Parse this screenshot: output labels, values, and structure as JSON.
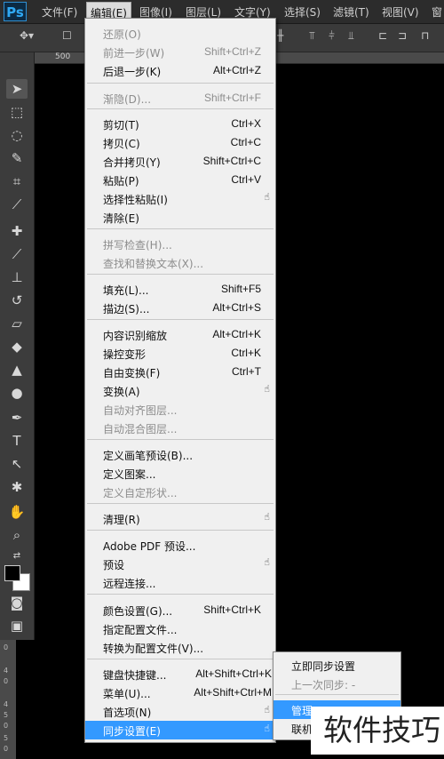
{
  "app": {
    "logo": "Ps"
  },
  "menubar": [
    "文件(F)",
    "编辑(E)",
    "图像(I)",
    "图层(L)",
    "文字(Y)",
    "选择(S)",
    "滤镜(T)",
    "视图(V)",
    "窗"
  ],
  "ruler": {
    "tick": "500",
    "left_ticks": [
      "0",
      "4",
      "0",
      "4",
      "5",
      "0",
      "5",
      "0"
    ]
  },
  "edit_menu": [
    {
      "label": "还原(O)",
      "shortcut": "",
      "disabled": true
    },
    {
      "label": "前进一步(W)",
      "shortcut": "Shift+Ctrl+Z",
      "disabled": true
    },
    {
      "label": "后退一步(K)",
      "shortcut": "Alt+Ctrl+Z"
    },
    {
      "label": "渐隐(D)...",
      "shortcut": "Shift+Ctrl+F",
      "disabled": true
    },
    {
      "label": "剪切(T)",
      "shortcut": "Ctrl+X"
    },
    {
      "label": "拷贝(C)",
      "shortcut": "Ctrl+C"
    },
    {
      "label": "合并拷贝(Y)",
      "shortcut": "Shift+Ctrl+C"
    },
    {
      "label": "粘贴(P)",
      "shortcut": "Ctrl+V"
    },
    {
      "label": "选择性粘贴(I)",
      "shortcut": "",
      "submenu": true
    },
    {
      "label": "清除(E)",
      "shortcut": ""
    },
    {
      "label": "拼写检查(H)...",
      "shortcut": "",
      "disabled": true
    },
    {
      "label": "查找和替换文本(X)...",
      "shortcut": "",
      "disabled": true
    },
    {
      "label": "填充(L)...",
      "shortcut": "Shift+F5"
    },
    {
      "label": "描边(S)...",
      "shortcut": "Alt+Ctrl+S"
    },
    {
      "label": "内容识别缩放",
      "shortcut": "Alt+Ctrl+K"
    },
    {
      "label": "操控变形",
      "shortcut": "Ctrl+K"
    },
    {
      "label": "自由变换(F)",
      "shortcut": "Ctrl+T"
    },
    {
      "label": "变换(A)",
      "shortcut": "",
      "submenu": true
    },
    {
      "label": "自动对齐图层...",
      "shortcut": "",
      "disabled": true
    },
    {
      "label": "自动混合图层...",
      "shortcut": "",
      "disabled": true
    },
    {
      "label": "定义画笔预设(B)...",
      "shortcut": ""
    },
    {
      "label": "定义图案...",
      "shortcut": ""
    },
    {
      "label": "定义自定形状...",
      "shortcut": "",
      "disabled": true
    },
    {
      "label": "清理(R)",
      "shortcut": "",
      "submenu": true
    },
    {
      "label": "Adobe PDF 预设...",
      "shortcut": ""
    },
    {
      "label": "预设",
      "shortcut": "",
      "submenu": true
    },
    {
      "label": "远程连接...",
      "shortcut": ""
    },
    {
      "label": "颜色设置(G)...",
      "shortcut": "Shift+Ctrl+K"
    },
    {
      "label": "指定配置文件...",
      "shortcut": ""
    },
    {
      "label": "转换为配置文件(V)...",
      "shortcut": ""
    },
    {
      "label": "键盘快捷键...",
      "shortcut": "Alt+Shift+Ctrl+K"
    },
    {
      "label": "菜单(U)...",
      "shortcut": "Alt+Shift+Ctrl+M"
    },
    {
      "label": "首选项(N)",
      "shortcut": "",
      "submenu": true
    },
    {
      "label": "同步设置(E)",
      "shortcut": "",
      "submenu": true,
      "highlighted": true
    }
  ],
  "sync_submenu": [
    {
      "label": "立即同步设置",
      "disabled": false
    },
    {
      "label": "上一次同步: -",
      "disabled": true
    },
    {
      "label": "管理",
      "highlighted": true
    },
    {
      "label": "联机",
      "disabled": false
    }
  ],
  "watermark": "软件技巧",
  "colors": {
    "menu_bg": "#f0f0f0",
    "highlight": "#3399ff",
    "toolbar": "#3c3c3c",
    "menubar": "#2c2c2c"
  }
}
